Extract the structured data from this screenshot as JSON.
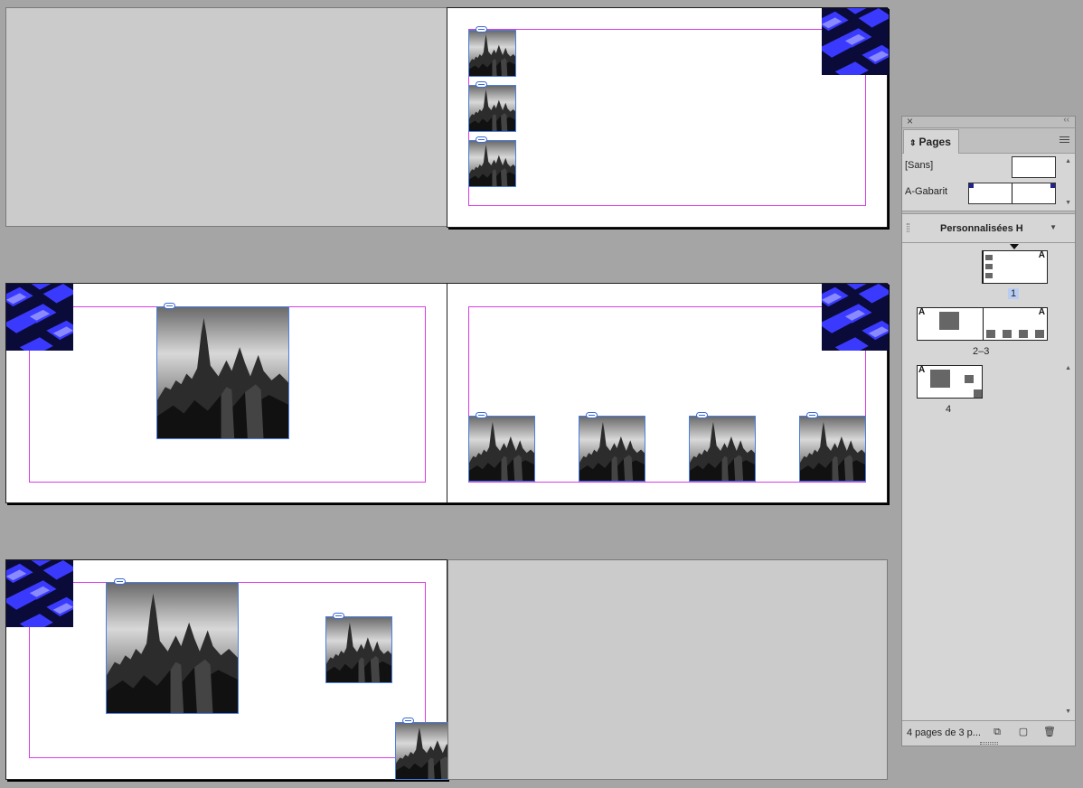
{
  "panel": {
    "tab_label": "Pages",
    "masters": [
      {
        "label": "[Sans]"
      },
      {
        "label": "A-Gabarit"
      }
    ],
    "view_mode": "Personnalisées H",
    "pages": [
      {
        "label": "1",
        "master_mark": "A"
      },
      {
        "label": "2–3",
        "master_mark": "A"
      },
      {
        "label": "4",
        "master_mark": "A"
      }
    ],
    "footer_text": "4 pages de 3 p...",
    "icons": [
      "close-icon",
      "collapse-icon",
      "panel-menu-icon",
      "edit-page-size-icon",
      "new-page-icon",
      "trash-icon"
    ]
  },
  "colors": {
    "pasteboard": "#a5a5a5",
    "margin_guide": "#d93ce8",
    "frame_edge": "#4a7fe0",
    "selection_highlight": "#b9cdf3"
  }
}
